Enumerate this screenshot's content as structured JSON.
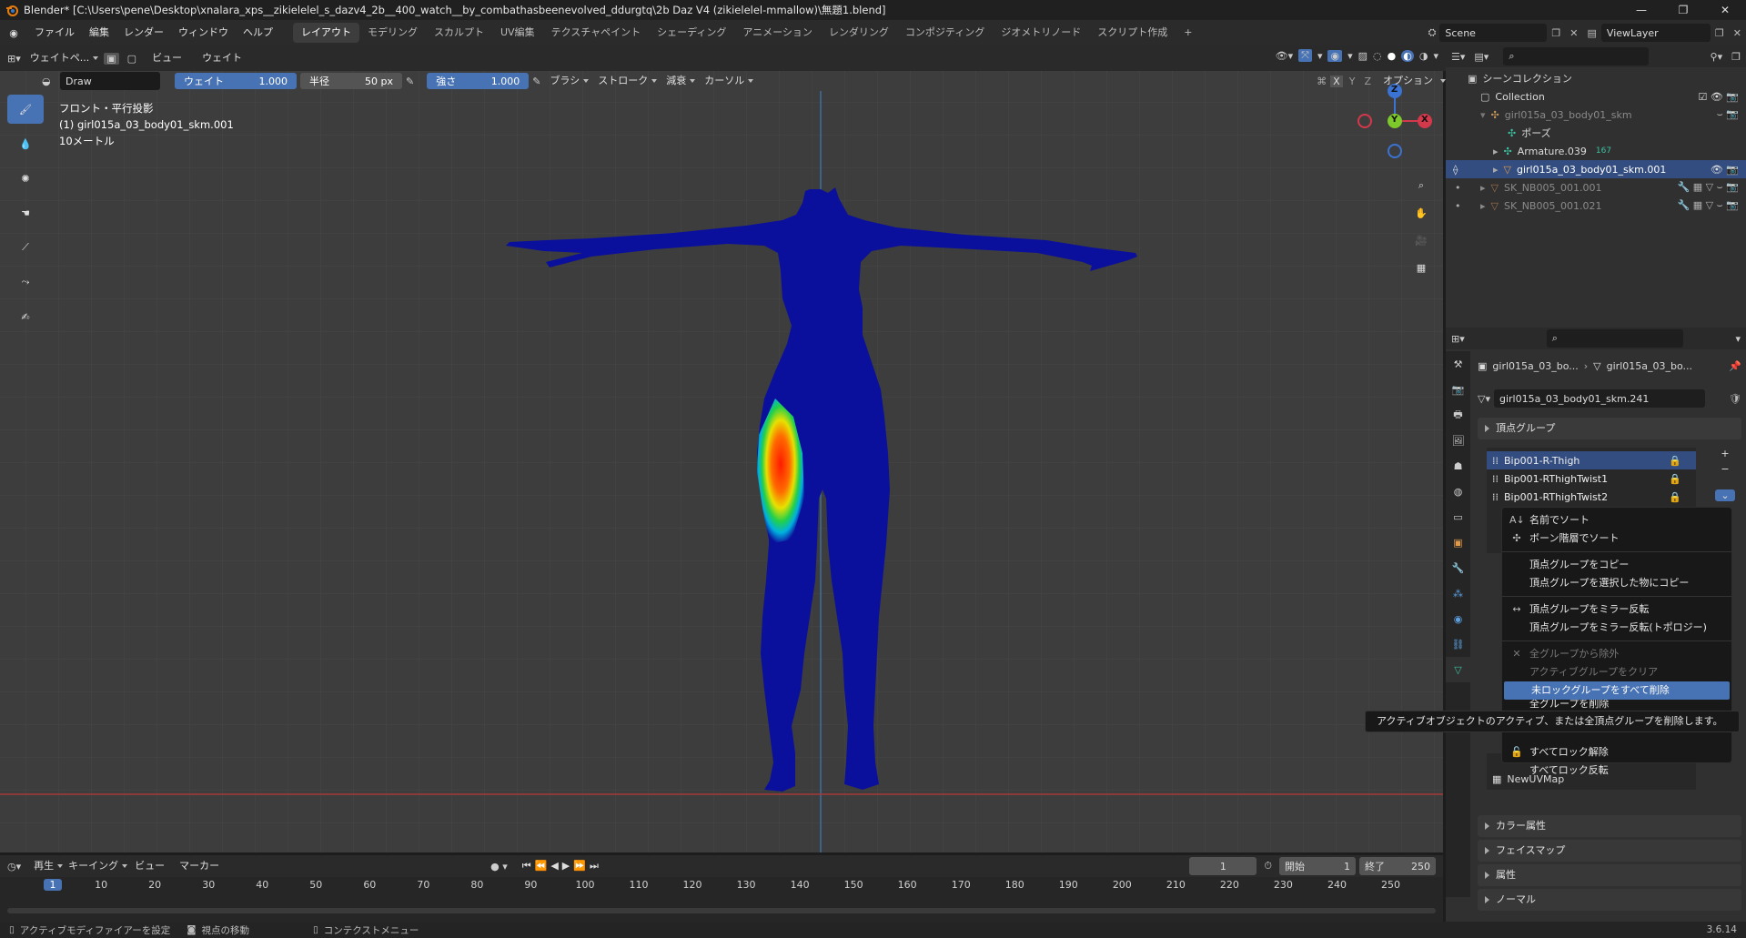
{
  "window": {
    "title": "Blender* [C:\\Users\\pene\\Desktop\\xnalara_xps__zikielelel_s_dazv4_2b__400_watch__by_combathasbeenevolved_ddurgtq\\2b Daz V4 (zikielelel-mmallow)\\無題1.blend]",
    "minimize": "—",
    "maximize": "❐",
    "close": "✕"
  },
  "menubar": {
    "menus": [
      "ファイル",
      "編集",
      "レンダー",
      "ウィンドウ",
      "ヘルプ"
    ],
    "workspaces": [
      "レイアウト",
      "モデリング",
      "スカルプト",
      "UV編集",
      "テクスチャペイント",
      "シェーディング",
      "アニメーション",
      "レンダリング",
      "コンポジティング",
      "ジオメトリノード",
      "スクリプト作成"
    ],
    "add_tab": "+",
    "scene": "Scene",
    "view_layer": "ViewLayer"
  },
  "viewport_header": {
    "mode": "ウェイトペ...",
    "view": "ビュー",
    "weight_menu": "ウェイト"
  },
  "tool_settings": {
    "brush_name": "Draw",
    "weight_label": "ウェイト",
    "weight_value": "1.000",
    "radius_label": "半径",
    "radius_value": "50 px",
    "strength_label": "強さ",
    "strength_value": "1.000",
    "brush_menu": "ブラシ",
    "stroke_menu": "ストローク",
    "falloff_menu": "減衰",
    "cursor_menu": "カーソル",
    "x": "X",
    "y": "Y",
    "z": "Z",
    "options": "オプション"
  },
  "viewport_info": {
    "line1": "フロント・平行投影",
    "line2": "(1) girl015a_03_body01_skm.001",
    "line3": "10メートル"
  },
  "gizmo": {
    "z": "Z",
    "y": "Y",
    "x": "X"
  },
  "outliner": {
    "scene_collection": "シーンコレクション",
    "collection": "Collection",
    "items": [
      {
        "name": "girl015a_03_body01_skm",
        "dim": true
      },
      {
        "name": "ポーズ",
        "dim": false
      },
      {
        "name": "Armature.039",
        "dim": false,
        "badge": "167"
      },
      {
        "name": "girl015a_03_body01_skm.001",
        "dim": false
      },
      {
        "name": "SK_NB005_001.001",
        "dim": true
      },
      {
        "name": "SK_NB005_001.021",
        "dim": true
      }
    ]
  },
  "properties": {
    "breadcrumb_obj": "girl015a_03_bo...",
    "breadcrumb_data": "girl015a_03_bo...",
    "mesh_name": "girl015a_03_body01_skm.241",
    "vertex_groups_title": "頂点グループ",
    "vertex_groups": [
      "Bip001-R-Thigh",
      "Bip001-RThighTwist1",
      "Bip001-RThighTwist2"
    ],
    "uvmap_fragment": "NewUVMap",
    "sections": [
      "カラー属性",
      "フェイスマップ",
      "属性",
      "ノーマル"
    ]
  },
  "context_menu": {
    "groups": [
      [
        {
          "label": "名前でソート",
          "icon": "sort-alpha-icon"
        },
        {
          "label": "ボーン階層でソート",
          "icon": "bone-icon"
        }
      ],
      [
        {
          "label": "頂点グループをコピー"
        },
        {
          "label": "頂点グループを選択した物にコピー"
        }
      ],
      [
        {
          "label": "頂点グループをミラー反転",
          "icon": "mirror-icon"
        },
        {
          "label": "頂点グループをミラー反転(トポロジー)"
        }
      ],
      [
        {
          "label": "全グループから除外",
          "disabled": true,
          "icon": "x-icon"
        },
        {
          "label": "アクティブグループをクリア",
          "disabled": true
        },
        {
          "label": "未ロックグループをすべて削除",
          "highlight": true
        },
        {
          "label": "全グループを削除"
        }
      ],
      [
        {
          "label": "すべてロック解除",
          "icon": "unlock-icon"
        },
        {
          "label": "すべてロック反転"
        }
      ]
    ]
  },
  "tooltip": {
    "text": "アクティブオブジェクトのアクティブ、または全頂点グループを削除します。"
  },
  "timeline": {
    "play_menu": "再生",
    "keying_menu": "キーイング",
    "view_menu": "ビュー",
    "marker_menu": "マーカー",
    "current_frame": "1",
    "start_label": "開始",
    "start_value": "1",
    "end_label": "終了",
    "end_value": "250",
    "ticks": [
      "1",
      "10",
      "20",
      "30",
      "40",
      "50",
      "60",
      "70",
      "80",
      "90",
      "100",
      "110",
      "120",
      "130",
      "140",
      "150",
      "160",
      "170",
      "180",
      "190",
      "200",
      "210",
      "220",
      "230",
      "240",
      "250"
    ]
  },
  "statusbar": {
    "item1": "アクティブモディファイアーを設定",
    "item2": "視点の移動",
    "item3": "コンテクストメニュー",
    "version": "3.6.14"
  },
  "colors": {
    "accent": "#4772b3",
    "body": "#0b109c",
    "bg": "#3d3d3d"
  }
}
